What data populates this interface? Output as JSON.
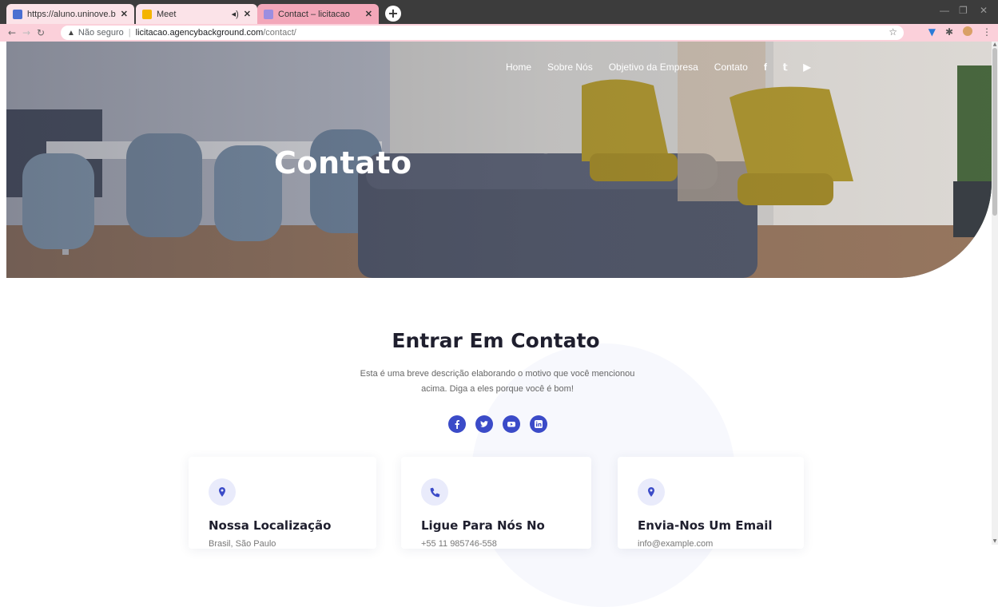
{
  "browser": {
    "tabs": [
      {
        "label": "https://aluno.uninove.br/sala_on",
        "close": "✕"
      },
      {
        "label": "Meet",
        "audio": "◂)",
        "close": "✕"
      },
      {
        "label": "Contact – licitacao",
        "close": "✕"
      }
    ],
    "new_tab": "+",
    "address": {
      "security_label": "Não seguro",
      "host": "licitacao.agencybackground.com",
      "path": "/contact/"
    }
  },
  "site": {
    "nav": [
      "Home",
      "Sobre Nós",
      "Objetivo da Empresa",
      "Contato"
    ],
    "nav_social": [
      "f",
      "𝕥",
      "▶"
    ],
    "hero_title": "Contato",
    "section_title": "Entrar Em Contato",
    "section_desc": "Esta é uma breve descrição elaborando o motivo que você mencionou acima. Diga a eles porque você é bom!",
    "social_icons": [
      "facebook-icon",
      "twitter-icon",
      "youtube-icon",
      "linkedin-icon"
    ],
    "cards": [
      {
        "icon": "location-pin-icon",
        "title": "Nossa Localização",
        "text": "Brasil, São Paulo"
      },
      {
        "icon": "phone-icon",
        "title": "Ligue Para Nós No",
        "text": "+55 11 985746-558"
      },
      {
        "icon": "location-pin-icon",
        "title": "Envia-Nos Um Email",
        "text": "info@example.com"
      }
    ]
  },
  "colors": {
    "accent": "#3b4bc8",
    "tab_active": "#f3a7b9",
    "address_bar": "#fbd0da"
  }
}
